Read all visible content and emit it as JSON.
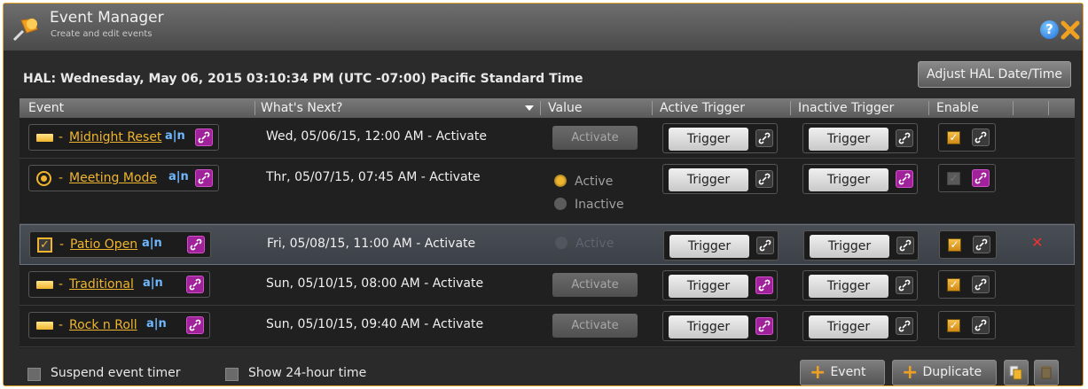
{
  "window": {
    "title": "Event Manager",
    "subtitle": "Create and edit events",
    "help_label": "?"
  },
  "hal": {
    "status": "HAL:  Wednesday, May 06, 2015  03:10:34 PM   (UTC -07:00) Pacific Standard Time",
    "adjust_label": "Adjust HAL Date/Time"
  },
  "columns": [
    "Event",
    "What's Next?",
    "Value",
    "Active Trigger",
    "Inactive Trigger",
    "Enable"
  ],
  "rows": [
    {
      "name": "Midnight Reset",
      "icon": "bar-icon",
      "next": "Wed, 05/06/15, 12:00 AM - Activate",
      "value_type": "button",
      "value_label": "Activate",
      "active_trigger": "Trigger",
      "active_link": "dark",
      "inactive_trigger": "Trigger",
      "inactive_link": "dark",
      "enabled": true,
      "enable_link": "dark"
    },
    {
      "name": "Meeting Mode",
      "icon": "radio-icon",
      "next": "Thr, 05/07/15, 07:45 AM - Activate",
      "value_type": "radio",
      "value_options": [
        "Active",
        "Inactive"
      ],
      "active_trigger": "Trigger",
      "active_link": "dark",
      "inactive_trigger": "Trigger",
      "inactive_link": "pink",
      "enabled": false,
      "enable_link": "pink"
    },
    {
      "name": "Patio Open",
      "icon": "checkbox-icon",
      "next": "Fri, 05/08/15, 11:00 AM - Activate",
      "value_type": "radio-single",
      "value_options": [
        "Active"
      ],
      "active_trigger": "Trigger",
      "active_link": "dark",
      "inactive_trigger": "Trigger",
      "inactive_link": "dark",
      "enabled": true,
      "enable_link": "dark",
      "delete_label": "✕"
    },
    {
      "name": "Traditional",
      "icon": "bar-icon",
      "next": "Sun, 05/10/15, 08:00 AM - Activate",
      "value_type": "button",
      "value_label": "Activate",
      "active_trigger": "Trigger",
      "active_link": "pink",
      "inactive_trigger": "Trigger",
      "inactive_link": "dark",
      "enabled": true,
      "enable_link": "dark"
    },
    {
      "name": "Rock n Roll",
      "icon": "bar-icon",
      "next": "Sun, 05/10/15, 09:40 AM - Activate",
      "value_type": "button",
      "value_label": "Activate",
      "active_trigger": "Trigger",
      "active_link": "pink",
      "inactive_trigger": "Trigger",
      "inactive_link": "dark",
      "enabled": true,
      "enable_link": "dark"
    }
  ],
  "footer": {
    "suspend_label": "Suspend event timer",
    "show24_label": "Show 24-hour time",
    "add_event_label": "Event",
    "duplicate_label": "Duplicate"
  },
  "colors": {
    "accent": "#f0b52e",
    "link_active": "#a0229a",
    "delete": "#e33333"
  }
}
